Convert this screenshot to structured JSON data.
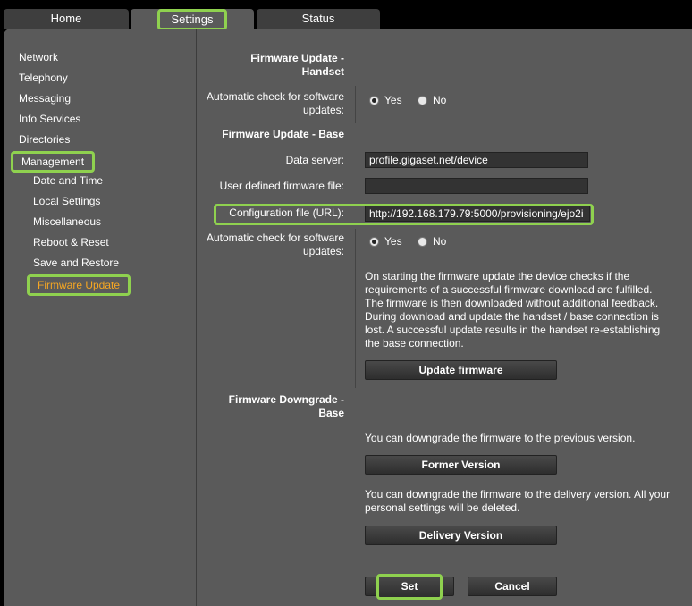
{
  "tabs": [
    {
      "label": "Home"
    },
    {
      "label": "Settings",
      "active": true
    },
    {
      "label": "Status"
    }
  ],
  "sidebar": {
    "items": [
      {
        "label": "Network"
      },
      {
        "label": "Telephony"
      },
      {
        "label": "Messaging"
      },
      {
        "label": "Info Services"
      },
      {
        "label": "Directories"
      },
      {
        "label": "Management"
      }
    ],
    "subitems": [
      {
        "label": "Date and Time"
      },
      {
        "label": "Local Settings"
      },
      {
        "label": "Miscellaneous"
      },
      {
        "label": "Reboot & Reset"
      },
      {
        "label": "Save and Restore"
      },
      {
        "label": "Firmware Update"
      }
    ]
  },
  "handset": {
    "heading_line1": "Firmware Update -",
    "heading_line2": "Handset",
    "auto_check_line1": "Automatic check for software",
    "auto_check_line2": "updates:",
    "yes": "Yes",
    "no": "No"
  },
  "base": {
    "heading": "Firmware Update - Base",
    "data_server_label": "Data server:",
    "data_server_value": "profile.gigaset.net/device",
    "user_fw_label": "User defined firmware file:",
    "user_fw_value": "",
    "config_file_label": "Configuration file (URL):",
    "config_file_value": "http://192.168.179.79:5000/provisioning/ejo2i",
    "auto_check_line1": "Automatic check for software",
    "auto_check_line2": "updates:",
    "yes": "Yes",
    "no": "No",
    "info": [
      "On starting the firmware update the device checks if the",
      "requirements of a successful firmware download are fulfilled.",
      "The firmware is then downloaded without additional feedback.",
      "During download and update the handset / base connection is",
      "lost. A successful update results in the handset re-establishing",
      "the base connection."
    ],
    "update_button": "Update firmware"
  },
  "downgrade": {
    "heading_line1": "Firmware Downgrade -",
    "heading_line2": "Base",
    "prev_text": "You can downgrade the firmware to the previous version.",
    "former_button": "Former Version",
    "delivery_text_line1": "You can downgrade the firmware to the delivery version. All your",
    "delivery_text_line2": "personal settings will be deleted.",
    "delivery_button": "Delivery Version"
  },
  "actions": {
    "set": "Set",
    "cancel": "Cancel"
  },
  "colors": {
    "highlight": "#8fd14f",
    "current_nav": "#f5a623",
    "panel": "#5a5a5a"
  }
}
